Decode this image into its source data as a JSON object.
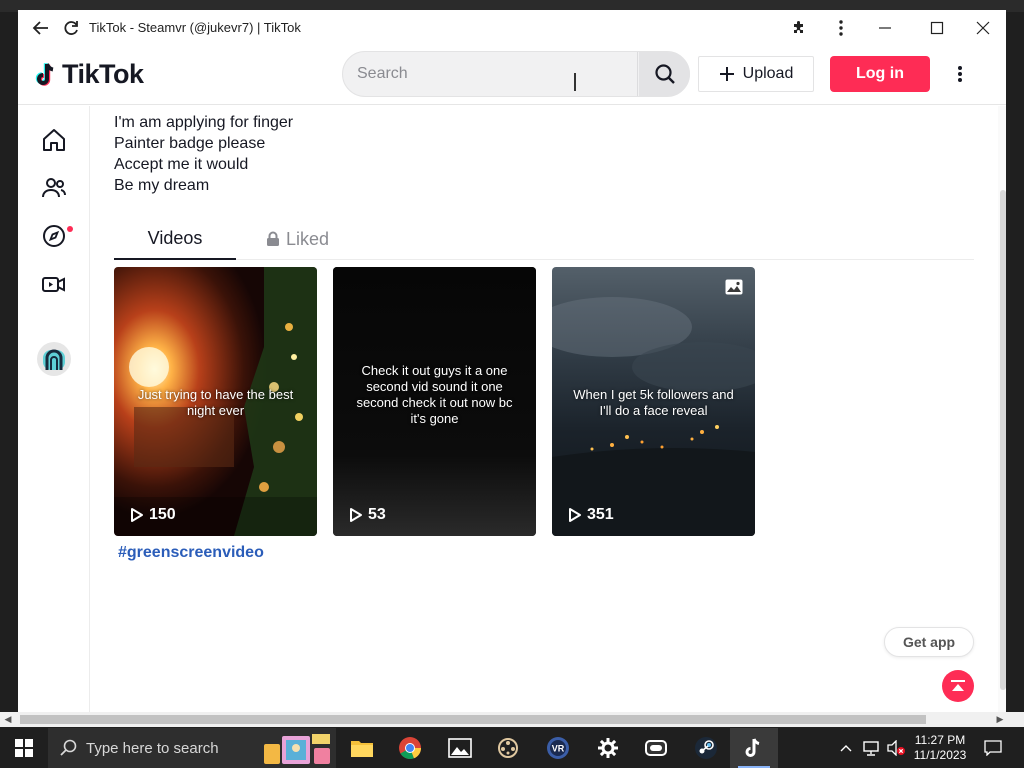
{
  "browser": {
    "title": "TikTok - Steamvr (@jukevr7) | TikTok"
  },
  "header": {
    "logo_text": "TikTok",
    "search_placeholder": "Search",
    "upload_label": "Upload",
    "login_label": "Log in"
  },
  "sidebar": {
    "items": [
      "home-icon",
      "following-icon",
      "explore-icon",
      "live-icon",
      "avatar"
    ]
  },
  "profile": {
    "bio_lines": [
      "I'm am applying for finger",
      "Painter badge please",
      "Accept me it would",
      "Be my dream"
    ]
  },
  "tabs": {
    "videos_label": "Videos",
    "liked_label": "Liked"
  },
  "videos": [
    {
      "caption": "Just trying to have the best night ever",
      "views": "150"
    },
    {
      "caption": "Check it out guys it a one second vid sound it one second check it out now bc it's gone",
      "views": "53"
    },
    {
      "caption": "When I get 5k followers and I'll do a face reveal",
      "views": "351"
    }
  ],
  "hashtag": "#greenscreenvideo",
  "get_app_label": "Get app",
  "taskbar": {
    "search_placeholder": "Type here to search",
    "time": "11:27 PM",
    "date": "11/1/2023"
  },
  "colors": {
    "brand": "#fe2c55",
    "hashtag": "#2b5db9",
    "text": "#161823"
  }
}
